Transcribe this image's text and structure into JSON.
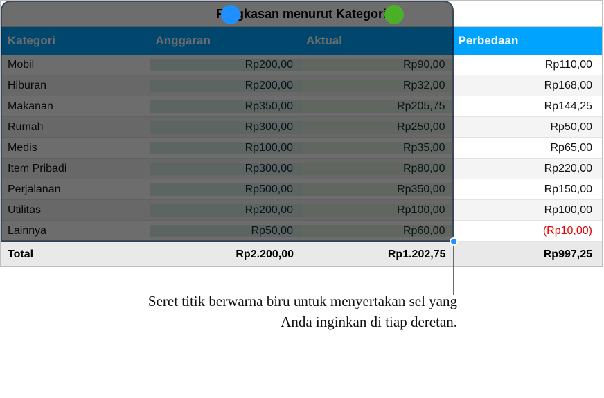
{
  "title": "Ringkasan menurut Kategori",
  "headers": {
    "kategori": "Kategori",
    "anggaran": "Anggaran",
    "aktual": "Aktual",
    "perbedaan": "Perbedaan"
  },
  "rows": [
    {
      "kategori": "Mobil",
      "anggaran": "Rp200,00",
      "aktual": "Rp90,00",
      "perbedaan": "Rp110,00",
      "neg": false
    },
    {
      "kategori": "Hiburan",
      "anggaran": "Rp200,00",
      "aktual": "Rp32,00",
      "perbedaan": "Rp168,00",
      "neg": false
    },
    {
      "kategori": "Makanan",
      "anggaran": "Rp350,00",
      "aktual": "Rp205,75",
      "perbedaan": "Rp144,25",
      "neg": false
    },
    {
      "kategori": "Rumah",
      "anggaran": "Rp300,00",
      "aktual": "Rp250,00",
      "perbedaan": "Rp50,00",
      "neg": false
    },
    {
      "kategori": "Medis",
      "anggaran": "Rp100,00",
      "aktual": "Rp35,00",
      "perbedaan": "Rp65,00",
      "neg": false
    },
    {
      "kategori": "Item Pribadi",
      "anggaran": "Rp300,00",
      "aktual": "Rp80,00",
      "perbedaan": "Rp220,00",
      "neg": false
    },
    {
      "kategori": "Perjalanan",
      "anggaran": "Rp500,00",
      "aktual": "Rp350,00",
      "perbedaan": "Rp150,00",
      "neg": false
    },
    {
      "kategori": "Utilitas",
      "anggaran": "Rp200,00",
      "aktual": "Rp100,00",
      "perbedaan": "Rp100,00",
      "neg": false
    },
    {
      "kategori": "Lainnya",
      "anggaran": "Rp50,00",
      "aktual": "Rp60,00",
      "perbedaan": "(Rp10,00)",
      "neg": true
    }
  ],
  "total": {
    "label": "Total",
    "anggaran": "Rp2.200,00",
    "aktual": "Rp1.202,75",
    "perbedaan": "Rp997,25"
  },
  "callout": "Seret titik berwarna biru untuk menyertakan sel yang Anda inginkan di tiap deretan."
}
